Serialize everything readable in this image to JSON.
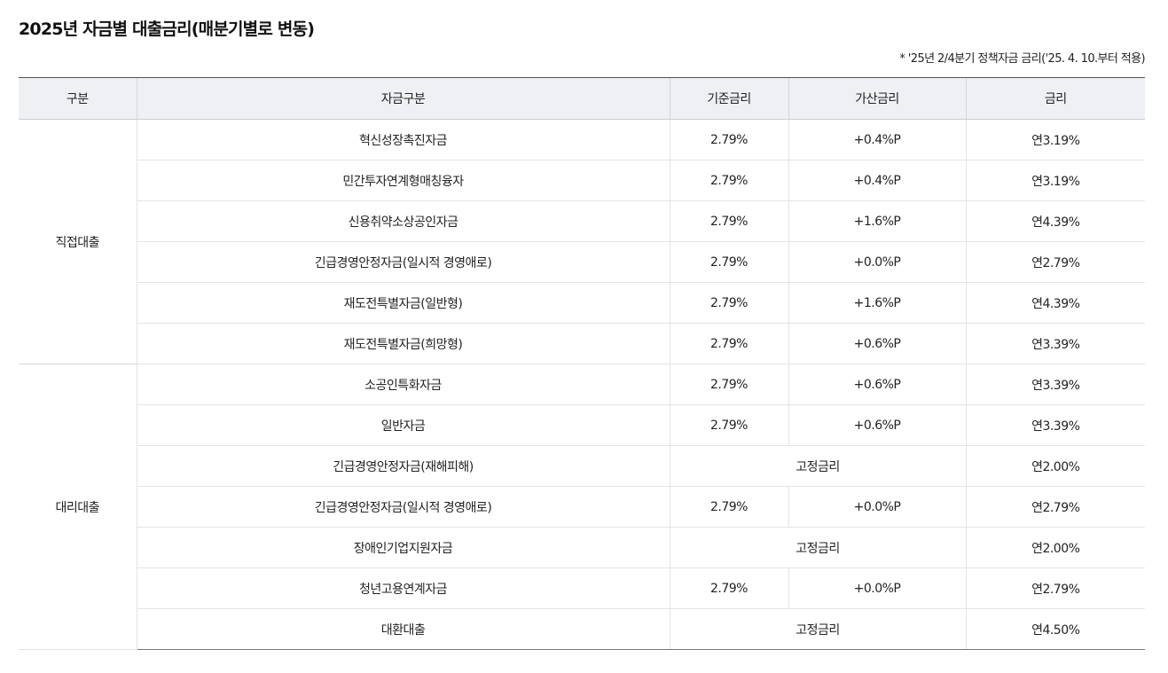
{
  "title": "2025년 자금별 대출금리(매분기별로 변동)",
  "note": "* '25년 2/4분기 정책자금 금리('25. 4. 10.부터 적용)",
  "table": {
    "headers": [
      "구분",
      "자금구분",
      "기준금리",
      "가산금리",
      "금리"
    ],
    "groups": [
      {
        "category": "직접대출",
        "rows": [
          {
            "fund": "혁신성장촉진자금",
            "base": "2.79%",
            "add": "+0.4%P",
            "rate": "연3.19%"
          },
          {
            "fund": "민간투자연계형매칭융자",
            "base": "2.79%",
            "add": "+0.4%P",
            "rate": "연3.19%"
          },
          {
            "fund": "신용취약소상공인자금",
            "base": "2.79%",
            "add": "+1.6%P",
            "rate": "연4.39%"
          },
          {
            "fund": "긴급경영안정자금(일시적 경영애로)",
            "base": "2.79%",
            "add": "+0.0%P",
            "rate": "연2.79%"
          },
          {
            "fund": "재도전특별자금(일반형)",
            "base": "2.79%",
            "add": "+1.6%P",
            "rate": "연4.39%"
          },
          {
            "fund": "재도전특별자금(희망형)",
            "base": "2.79%",
            "add": "+0.6%P",
            "rate": "연3.39%"
          }
        ]
      },
      {
        "category": "대리대출",
        "rows": [
          {
            "fund": "소공인특화자금",
            "base": "2.79%",
            "add": "+0.6%P",
            "rate": "연3.39%"
          },
          {
            "fund": "일반자금",
            "base": "2.79%",
            "add": "+0.6%P",
            "rate": "연3.39%"
          },
          {
            "fund": "긴급경영안정자금(재해피해)",
            "fixed": "고정금리",
            "rate": "연2.00%"
          },
          {
            "fund": "긴급경영안정자금(일시적 경영애로)",
            "base": "2.79%",
            "add": "+0.0%P",
            "rate": "연2.79%"
          },
          {
            "fund": "장애인기업지원자금",
            "fixed": "고정금리",
            "rate": "연2.00%"
          },
          {
            "fund": "청년고용연계자금",
            "base": "2.79%",
            "add": "+0.0%P",
            "rate": "연2.79%"
          },
          {
            "fund": "대환대출",
            "fixed": "고정금리",
            "rate": "연4.50%"
          }
        ]
      }
    ]
  }
}
